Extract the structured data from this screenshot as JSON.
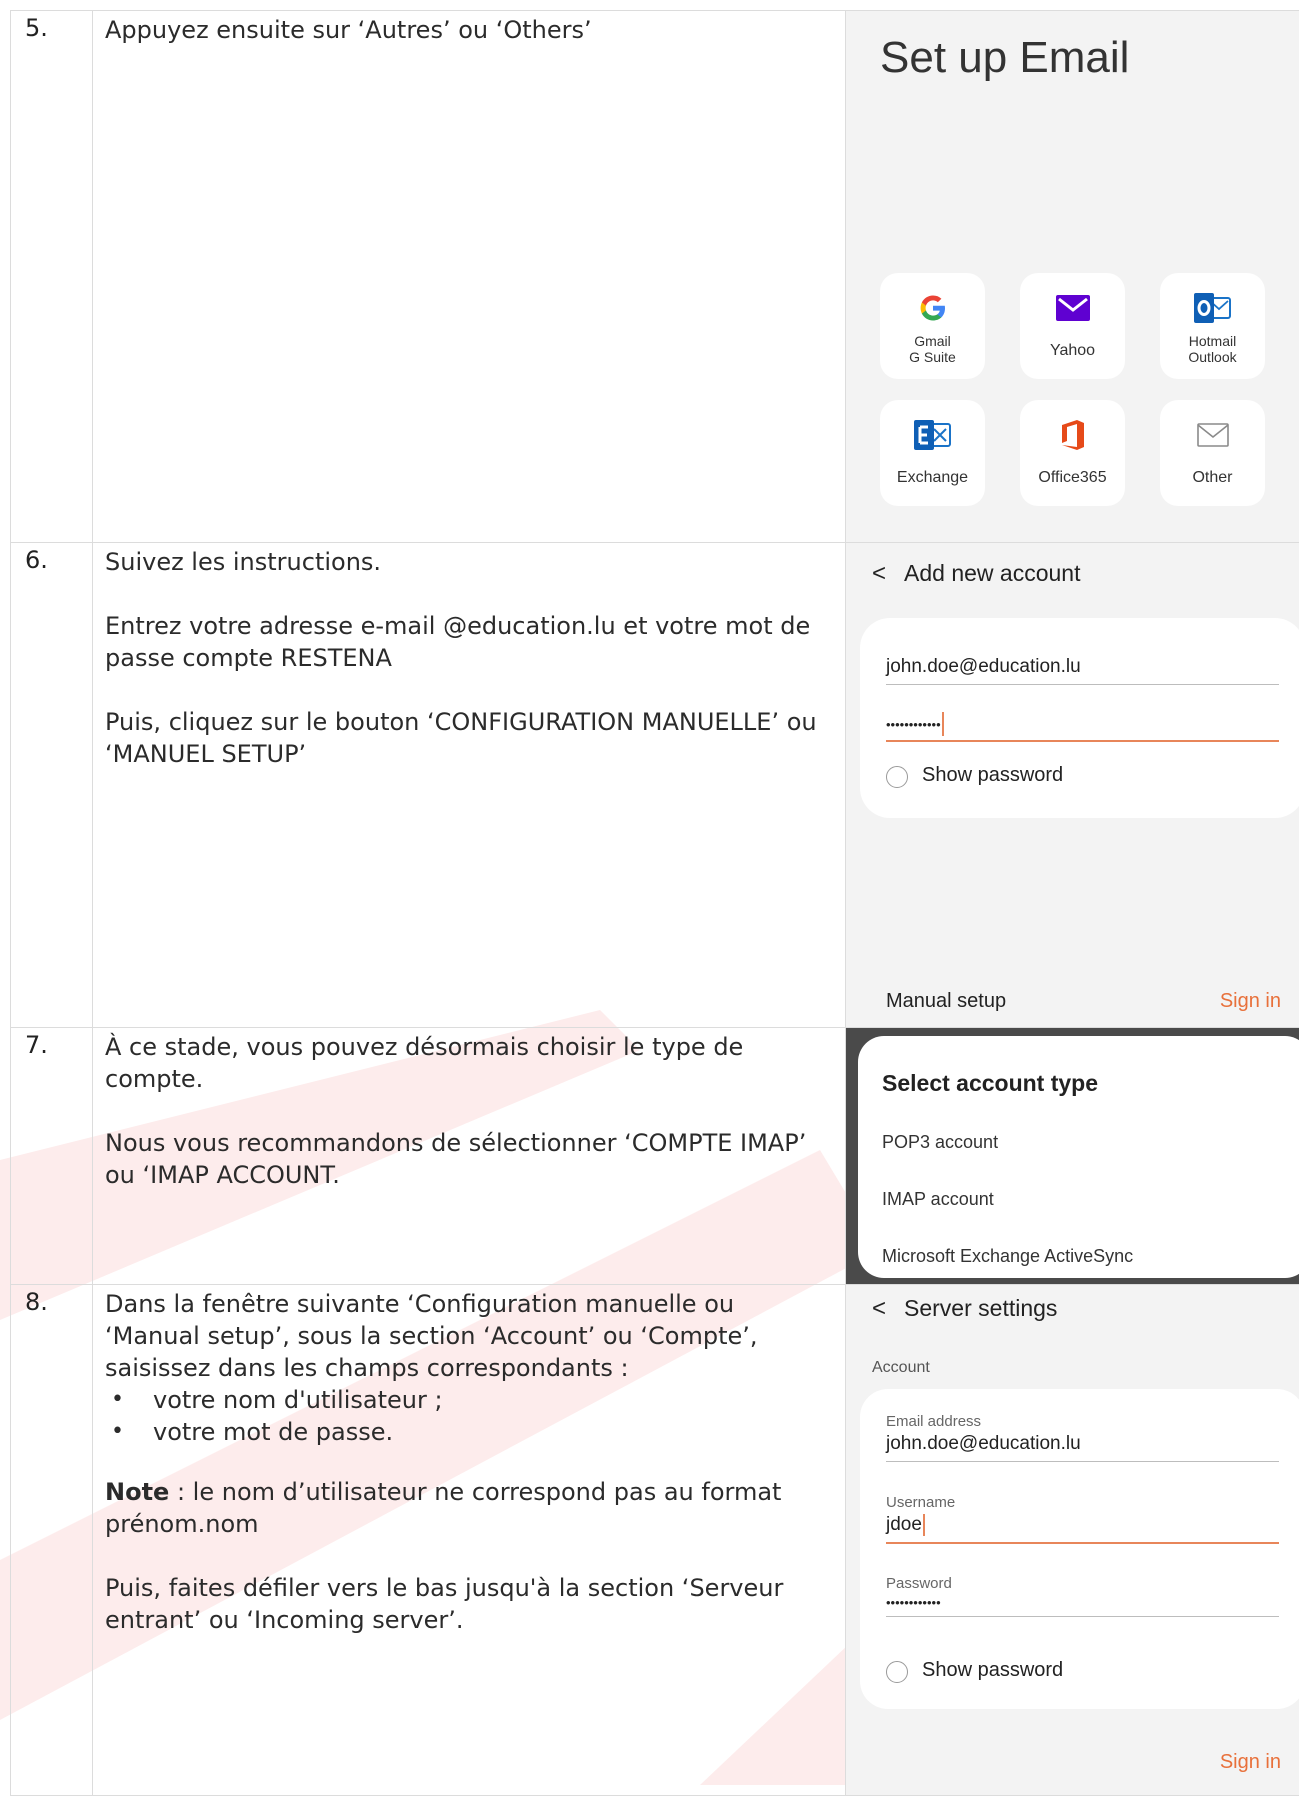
{
  "steps": [
    {
      "num": "5.",
      "text": "Appuyez ensuite sur ‘Autres’ ou ‘Others’",
      "screen": {
        "title": "Set up Email",
        "tiles": [
          {
            "line1": "Gmail",
            "line2": "G Suite",
            "icon": "google-g-icon"
          },
          {
            "line1": "Yahoo",
            "line2": "",
            "icon": "yahoo-envelope-icon"
          },
          {
            "line1": "Hotmail",
            "line2": "Outlook",
            "icon": "outlook-icon"
          },
          {
            "line1": "Exchange",
            "line2": "",
            "icon": "exchange-icon"
          },
          {
            "line1": "Office365",
            "line2": "",
            "icon": "office365-icon"
          },
          {
            "line1": "Other",
            "line2": "",
            "icon": "envelope-outline-icon"
          }
        ]
      }
    },
    {
      "num": "6.",
      "paragraphs": [
        "Suivez les instructions.",
        "Entrez votre adresse e-mail @education.lu et votre mot de passe compte RESTENA",
        "Puis, cliquez sur le bouton ‘CONFIGURATION MANUELLE’ ou ‘MANUEL SETUP’"
      ],
      "screen": {
        "header": "Add new account",
        "email": "john.doe@education.lu",
        "password": "••••••••••••",
        "show_password": "Show password",
        "manual_setup": "Manual setup",
        "sign_in": "Sign in"
      }
    },
    {
      "num": "7.",
      "paragraphs": [
        "À ce stade, vous pouvez désormais choisir le type de compte.",
        "Nous vous recommandons de sélectionner ‘COMPTE IMAP’ ou ‘IMAP ACCOUNT."
      ],
      "screen": {
        "title": "Select account type",
        "options": [
          "POP3 account",
          "IMAP account",
          "Microsoft Exchange ActiveSync"
        ]
      }
    },
    {
      "num": "8.",
      "intro": "Dans la fenêtre suivante ‘Configuration manuelle ou ‘Manual setup’, sous la section ‘Account’ ou ‘Compte’, saisissez dans les champs correspondants :",
      "bullets": [
        "votre nom d'utilisateur ;",
        "votre mot de passe."
      ],
      "note_label": "Note",
      "note_text": " : le nom d’utilisateur ne correspond pas au format prénom.nom",
      "outro": "Puis, faites défiler vers le bas jusqu'à la section ‘Serveur entrant’ ou ‘Incoming server’.",
      "screen": {
        "header": "Server settings",
        "section": "Account",
        "email_label": "Email address",
        "email_value": "john.doe@education.lu",
        "username_label": "Username",
        "username_value": "jdoe",
        "password_label": "Password",
        "password_value": "••••••••••••",
        "show_password": "Show password",
        "sign_in": "Sign in"
      }
    }
  ],
  "colors": {
    "accent": "#e8703a",
    "watermark": "#fbe3e3",
    "screen_bg": "#f3f3f3"
  }
}
